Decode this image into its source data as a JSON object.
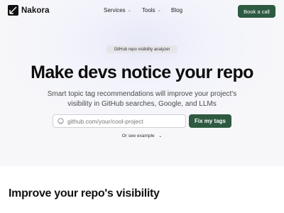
{
  "brand": {
    "name": "Nakora"
  },
  "nav": {
    "items": [
      {
        "label": "Services",
        "has_dropdown": true
      },
      {
        "label": "Tools",
        "has_dropdown": true
      },
      {
        "label": "Blog",
        "has_dropdown": false
      }
    ],
    "cta_label": "Book a call"
  },
  "hero": {
    "badge": "GitHub repo visibility analyzer",
    "title": "Make devs notice your repo",
    "subtitle": "Smart topic tag recommendations will improve your project's visibility in GitHub searches, Google, and LLMs",
    "search": {
      "placeholder": "github.com/your/cool-project",
      "value": "",
      "icon": "github-icon"
    },
    "submit_label": "Fix my tags",
    "example_label": "Or see example"
  },
  "section": {
    "title": "Improve your repo's visibility"
  },
  "colors": {
    "accent": "#2e5a41",
    "text": "#111111",
    "muted": "#4a4a4a"
  }
}
